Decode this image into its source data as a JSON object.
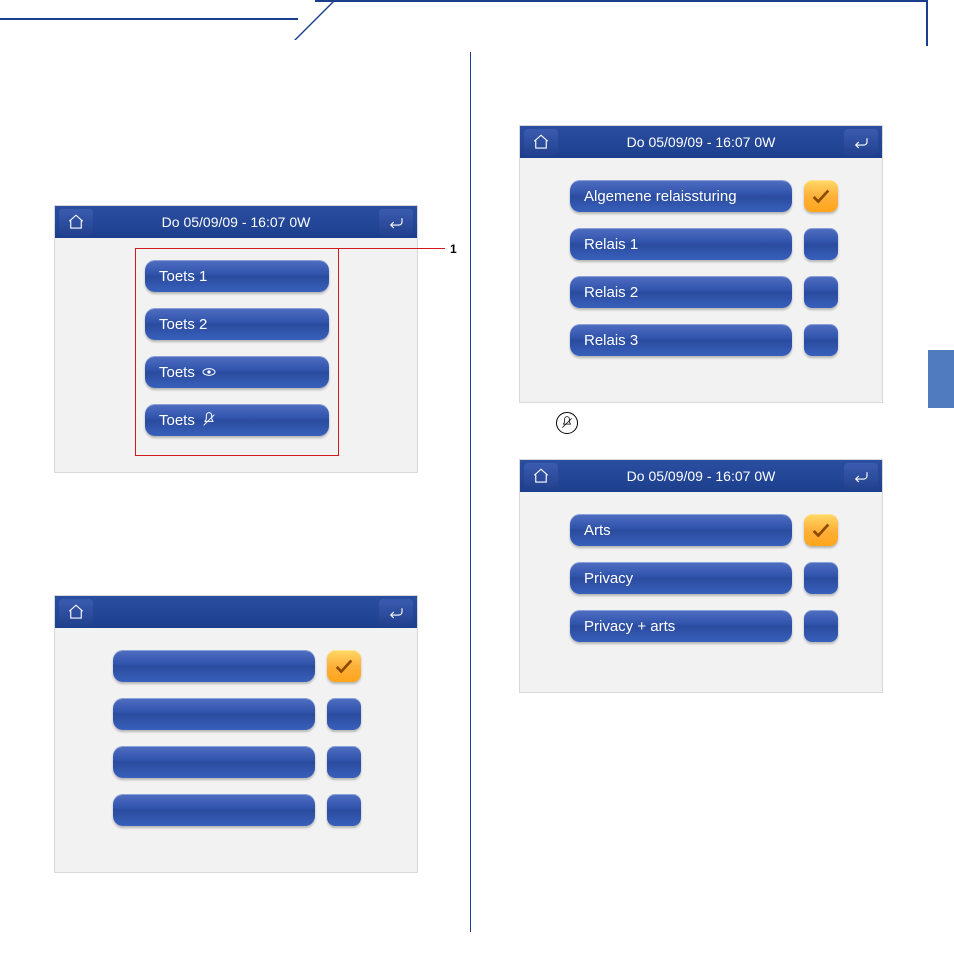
{
  "header_datetime": "Do 05/09/09 - 16:07   0W",
  "callout_1": "1",
  "screen1": {
    "items": [
      "Toets 1",
      "Toets 2",
      "Toets",
      "Toets"
    ]
  },
  "screen3": {
    "items": [
      "Algemene relaissturing",
      "Relais 1",
      "Relais 2",
      "Relais 3"
    ]
  },
  "screen4": {
    "items": [
      "Arts",
      "Privacy",
      "Privacy + arts"
    ]
  }
}
